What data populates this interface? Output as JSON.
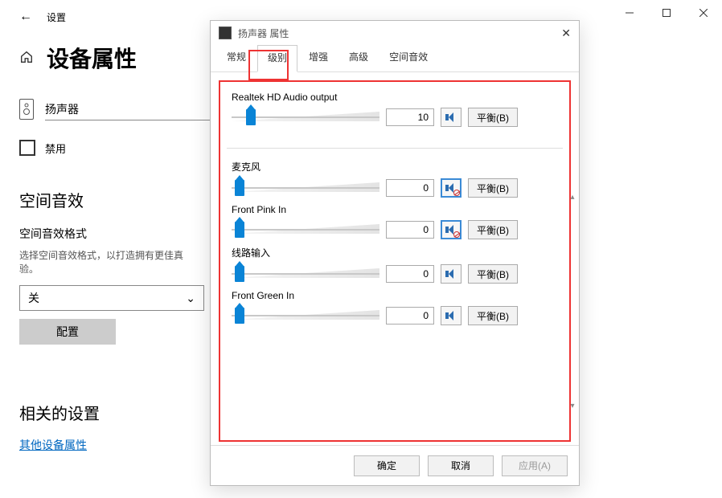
{
  "settings": {
    "app_label": "设置",
    "title": "设备属性",
    "device_name": "扬声器",
    "disable_label": "禁用",
    "spatial_audio_heading": "空间音效",
    "format_label": "空间音效格式",
    "format_desc": "选择空间音效格式，以打造拥有更佳真验。",
    "dropdown_value": "关",
    "configure_label": "配置",
    "related_heading": "相关的设置",
    "related_link": "其他设备属性"
  },
  "dialog": {
    "title": "扬声器 属性",
    "tabs": [
      "常规",
      "级别",
      "增强",
      "高级",
      "空间音效"
    ],
    "active_tab_index": 1,
    "balance_label": "平衡(B)",
    "channels": [
      {
        "label": "Realtek HD Audio output",
        "value": "10",
        "thumb_pct": 10,
        "muted": false,
        "selected": false
      },
      {
        "label": "麦克风",
        "value": "0",
        "thumb_pct": 2,
        "muted": true,
        "selected": true
      },
      {
        "label": "Front Pink In",
        "value": "0",
        "thumb_pct": 2,
        "muted": true,
        "selected": true
      },
      {
        "label": "线路输入",
        "value": "0",
        "thumb_pct": 2,
        "muted": false,
        "selected": false
      },
      {
        "label": "Front Green In",
        "value": "0",
        "thumb_pct": 2,
        "muted": false,
        "selected": false
      }
    ],
    "buttons": {
      "ok": "确定",
      "cancel": "取消",
      "apply": "应用(A)"
    }
  }
}
